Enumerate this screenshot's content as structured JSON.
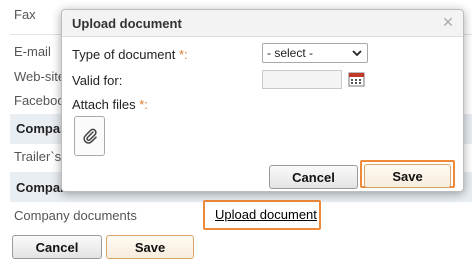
{
  "background_form": {
    "fields": [
      "Fax",
      "E-mail",
      "Web-site",
      "Facebook",
      "Trailer`s"
    ],
    "section_company": "Company",
    "section_company_2": "Compan",
    "company_documents_label": "Company documents",
    "upload_link": "Upload document",
    "cancel_label": "Cancel",
    "save_label": "Save"
  },
  "modal": {
    "title": "Upload document",
    "type_label": "Type of document",
    "type_required": "*:",
    "type_select_value": "- select -",
    "valid_for_label": "Valid for:",
    "attach_label": "Attach files",
    "attach_required": "*:",
    "cancel_label": "Cancel",
    "save_label": "Save"
  },
  "icons": {
    "close": "close-icon",
    "calendar": "calendar-icon",
    "attach": "paperclip-icon",
    "dropdown": "chevron-down-icon"
  },
  "colors": {
    "highlight": "#ef8a3a",
    "required": "#e07b2a",
    "section_bg": "#e9eef3"
  }
}
